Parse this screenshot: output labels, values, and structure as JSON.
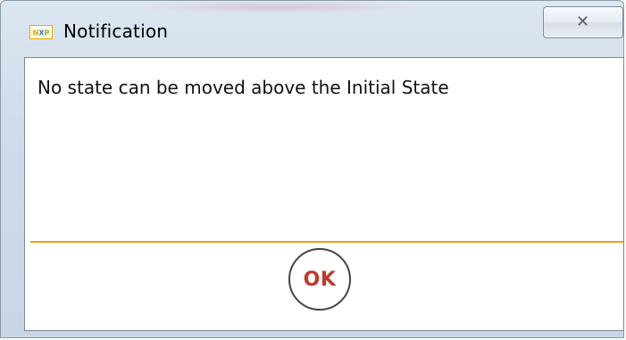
{
  "window": {
    "title": "Notification",
    "app_icon": "nxp-logo-icon",
    "close_glyph": "✕"
  },
  "dialog": {
    "message": "No state can be moved above the Initial State",
    "ok_label": "OK"
  },
  "colors": {
    "divider": "#e8a418",
    "ok_text": "#c0392b",
    "frame": "#cfdbea"
  }
}
